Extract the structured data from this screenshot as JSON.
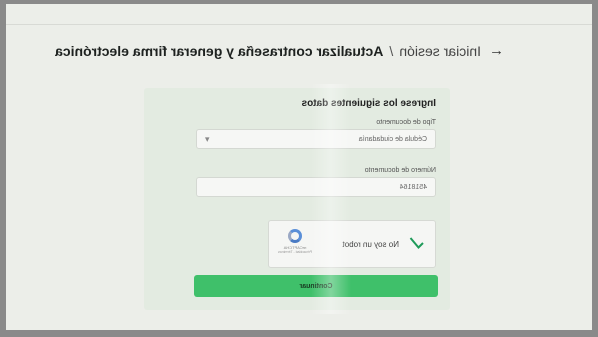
{
  "breadcrumb": {
    "arrow": "←",
    "link": "Iniciar sesión",
    "separator": "/",
    "current": "Actualizar contraseña y generar firma electrónica"
  },
  "form": {
    "title": "Ingrese los siguientes datos",
    "doc_type_label": "Tipo de documento",
    "doc_type_value": "Cédula de ciudadanía",
    "doc_number_label": "Número de documento",
    "doc_number_value": "4518164"
  },
  "captcha": {
    "checked": true,
    "label": "No soy un robot",
    "brand": "reCAPTCHA",
    "links": "Privacidad - Términos"
  },
  "submit": {
    "label": "Continuar"
  },
  "colors": {
    "primary_button": "#3fc06a",
    "card_bg": "#e3ebe1",
    "check": "#1f9b5a"
  },
  "icons": {
    "back": "arrow-left-icon",
    "dropdown": "chevron-down-icon",
    "check": "checkmark-icon",
    "captcha_logo": "recaptcha-logo-icon"
  }
}
